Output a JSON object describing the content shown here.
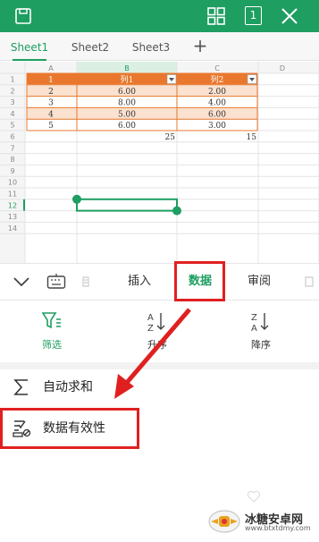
{
  "toolbar": {
    "save_icon": "save-icon",
    "grid_icon": "grid-icon",
    "page_count": "1",
    "close_icon": "close-icon"
  },
  "sheet_tabs": [
    {
      "label": "Sheet1",
      "active": true
    },
    {
      "label": "Sheet2",
      "active": false
    },
    {
      "label": "Sheet3",
      "active": false
    }
  ],
  "add_tab_label": "+",
  "spreadsheet": {
    "columns": [
      "A",
      "B",
      "C",
      "D"
    ],
    "rows": [
      "1",
      "2",
      "3",
      "4",
      "5",
      "6",
      "7",
      "8",
      "9",
      "10",
      "11",
      "12",
      "13",
      "14"
    ],
    "header_row": [
      "1",
      "列1",
      "列2"
    ],
    "data_rows": [
      [
        "2",
        "6.00",
        "2.00"
      ],
      [
        "3",
        "8.00",
        "4.00"
      ],
      [
        "4",
        "5.00",
        "6.00"
      ],
      [
        "5",
        "6.00",
        "3.00"
      ]
    ],
    "sum_row": {
      "b": "25",
      "c": "15"
    },
    "header_color": "#e9782e",
    "band_color": "#fbe1cf"
  },
  "ribbon": {
    "tabs": [
      "插入",
      "数据",
      "审阅"
    ],
    "active_tab": "数据"
  },
  "actions": [
    {
      "label": "筛选",
      "icon": "filter-icon"
    },
    {
      "label": "升序",
      "icon": "sort-ascending-icon"
    },
    {
      "label": "降序",
      "icon": "sort-descending-icon"
    }
  ],
  "menu": [
    {
      "label": "自动求和",
      "icon": "sigma-icon"
    },
    {
      "label": "数据有效性",
      "icon": "data-validation-icon"
    }
  ],
  "watermark": {
    "text": "冰糖安卓网",
    "sub": "www.btxtdmy.com"
  },
  "colors": {
    "brand": "#1e9e61",
    "highlight": "#e02020"
  }
}
